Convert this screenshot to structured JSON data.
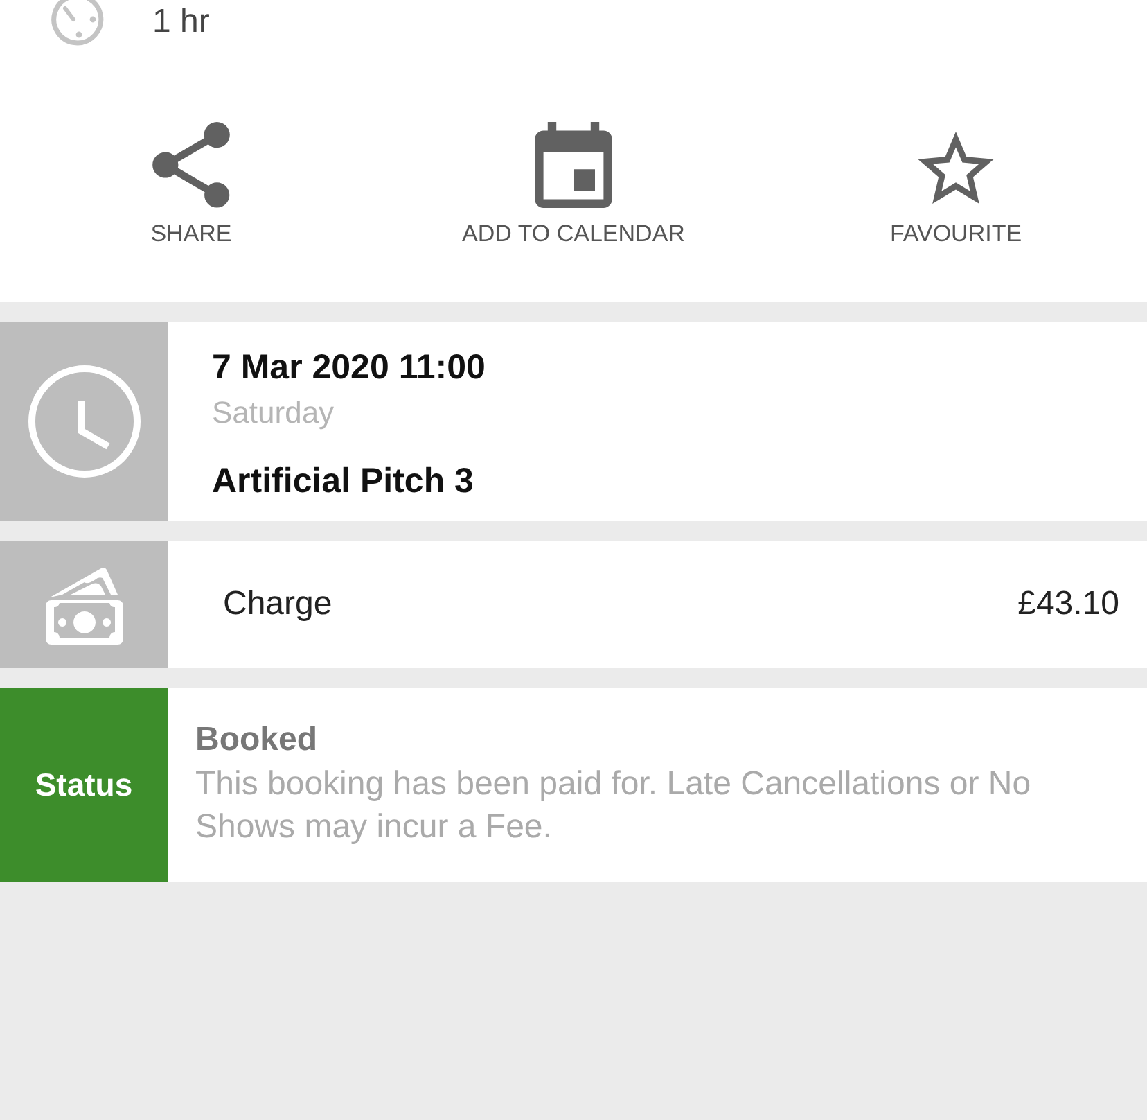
{
  "duration": {
    "text": "1 hr"
  },
  "actions": [
    {
      "kind": "share",
      "label": "SHARE"
    },
    {
      "kind": "calendar",
      "label": "ADD TO CALENDAR"
    },
    {
      "kind": "favourite",
      "label": "FAVOURITE"
    }
  ],
  "booking": {
    "date_time": "7 Mar 2020 11:00",
    "weekday": "Saturday",
    "resource": "Artificial Pitch 3"
  },
  "charge": {
    "label": "Charge",
    "amount": "£43.10"
  },
  "status": {
    "label": "Status",
    "state": "Booked",
    "message": "This booking has been paid for. Late Cancellations or No Shows may incur a Fee."
  }
}
